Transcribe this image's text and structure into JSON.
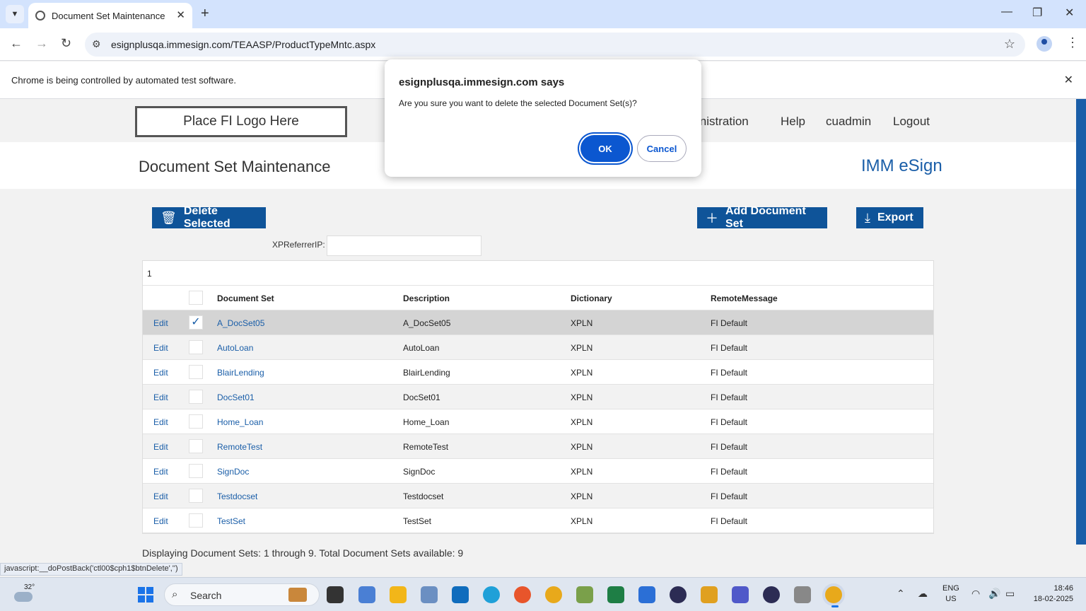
{
  "browser": {
    "tab_title": "Document Set Maintenance",
    "url": "esignplusqa.immesign.com/TEAASP/ProductTypeMntc.aspx",
    "infobar_message": "Chrome is being controlled by automated test software."
  },
  "header": {
    "logo_text": "Place FI Logo Here",
    "nav_administration": "inistration",
    "nav_help": "Help",
    "nav_user": "cuadmin",
    "nav_logout": "Logout"
  },
  "titlebar": {
    "page_title": "Document Set Maintenance",
    "brand": "IMM eSign"
  },
  "actions": {
    "delete_label": "Delete Selected",
    "add_label": "Add Document Set",
    "export_label": "Export"
  },
  "filter": {
    "label": "XPReferrerIP:",
    "value": ""
  },
  "grid": {
    "pager": "1",
    "headers": {
      "doc_set": "Document Set",
      "description": "Description",
      "dictionary": "Dictionary",
      "remote": "RemoteMessage"
    },
    "edit_label": "Edit",
    "rows": [
      {
        "name": "A_DocSet05",
        "desc": "A_DocSet05",
        "dict": "XPLN",
        "remote": "FI Default",
        "checked": true
      },
      {
        "name": "AutoLoan",
        "desc": "AutoLoan",
        "dict": "XPLN",
        "remote": "FI Default",
        "checked": false
      },
      {
        "name": "BlairLending",
        "desc": "BlairLending",
        "dict": "XPLN",
        "remote": "FI Default",
        "checked": false
      },
      {
        "name": "DocSet01",
        "desc": "DocSet01",
        "dict": "XPLN",
        "remote": "FI Default",
        "checked": false
      },
      {
        "name": "Home_Loan",
        "desc": "Home_Loan",
        "dict": "XPLN",
        "remote": "FI Default",
        "checked": false
      },
      {
        "name": "RemoteTest",
        "desc": "RemoteTest",
        "dict": "XPLN",
        "remote": "FI Default",
        "checked": false
      },
      {
        "name": "SignDoc",
        "desc": "SignDoc",
        "dict": "XPLN",
        "remote": "FI Default",
        "checked": false
      },
      {
        "name": "Testdocset",
        "desc": "Testdocset",
        "dict": "XPLN",
        "remote": "FI Default",
        "checked": false
      },
      {
        "name": "TestSet",
        "desc": "TestSet",
        "dict": "XPLN",
        "remote": "FI Default",
        "checked": false
      }
    ],
    "summary": "Displaying Document Sets: 1 through 9. Total Document Sets available: 9"
  },
  "status_bar": "javascript:__doPostBack('ctl00$cph1$btnDelete','')",
  "dialog": {
    "title": "esignplusqa.immesign.com says",
    "message": "Are you sure you want to delete the selected Document Set(s)?",
    "ok": "OK",
    "cancel": "Cancel"
  },
  "taskbar": {
    "temperature": "32°",
    "search_label": "Search",
    "lang_top": "ENG",
    "lang_bottom": "US",
    "time": "18:46",
    "date": "18-02-2025"
  },
  "colors": {
    "primary_button": "#0f5499",
    "link": "#1a5ea8",
    "dialog_ok": "#0b57d0"
  }
}
